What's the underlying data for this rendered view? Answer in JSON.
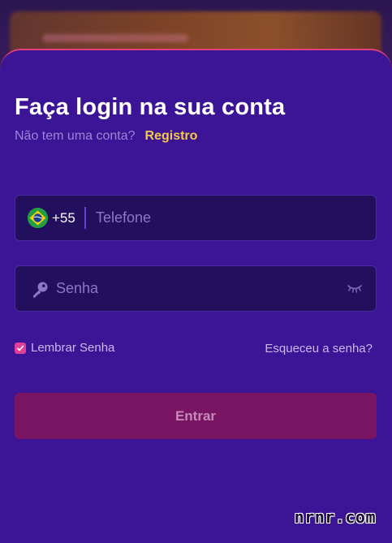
{
  "login": {
    "title": "Faça login na sua conta",
    "no_account_text": "Não tem uma conta?",
    "register_label": "Registro",
    "phone": {
      "country_code": "+55",
      "placeholder": "Telefone",
      "value": ""
    },
    "password": {
      "placeholder": "Senha",
      "value": ""
    },
    "remember_label": "Lembrar Senha",
    "remember_checked": true,
    "forgot_label": "Esqueceu a senha?",
    "submit_label": "Entrar"
  },
  "icons": {
    "flag": "brazil-flag-icon",
    "key": "key-icon",
    "eye": "eye-closed-icon",
    "check": "checkmark-icon"
  },
  "watermark": "nrnr.com",
  "colors": {
    "accent": "#f4c84a",
    "sheet_bg": "#3b1595",
    "field_bg": "#22105e",
    "checkbox": "#e0409a",
    "submit_bg": "#7a1563"
  }
}
